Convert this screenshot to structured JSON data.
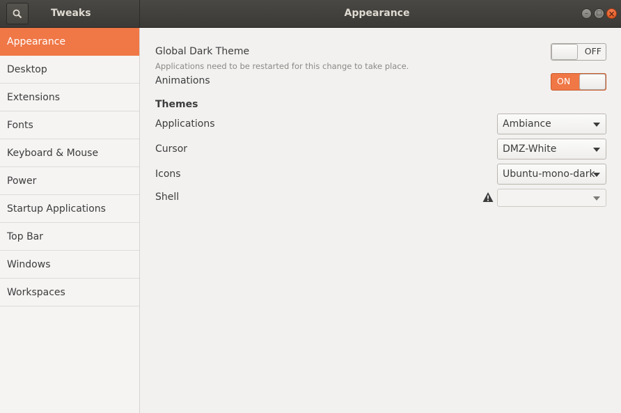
{
  "header": {
    "app_title": "Tweaks",
    "window_title": "Appearance",
    "search_icon": "search-icon",
    "minimize_glyph": "–",
    "maximize_glyph": "□",
    "close_glyph": "×"
  },
  "sidebar": {
    "items": [
      {
        "label": "Appearance",
        "selected": true
      },
      {
        "label": "Desktop"
      },
      {
        "label": "Extensions"
      },
      {
        "label": "Fonts"
      },
      {
        "label": "Keyboard & Mouse"
      },
      {
        "label": "Power"
      },
      {
        "label": "Startup Applications"
      },
      {
        "label": "Top Bar"
      },
      {
        "label": "Windows"
      },
      {
        "label": "Workspaces"
      }
    ]
  },
  "main": {
    "global_dark_theme": {
      "label": "Global Dark Theme",
      "note": "Applications need to be restarted for this change to take place.",
      "state": "OFF"
    },
    "animations": {
      "label": "Animations",
      "state": "ON"
    },
    "themes_heading": "Themes",
    "applications": {
      "label": "Applications",
      "value": "Ambiance"
    },
    "cursor": {
      "label": "Cursor",
      "value": "DMZ-White"
    },
    "icons": {
      "label": "Icons",
      "value": "Ubuntu-mono-dark"
    },
    "shell": {
      "label": "Shell",
      "value": ""
    }
  },
  "colors": {
    "accent": "#f07746",
    "header_bg": "#3b3a36",
    "window_bg": "#f2f1f0"
  }
}
